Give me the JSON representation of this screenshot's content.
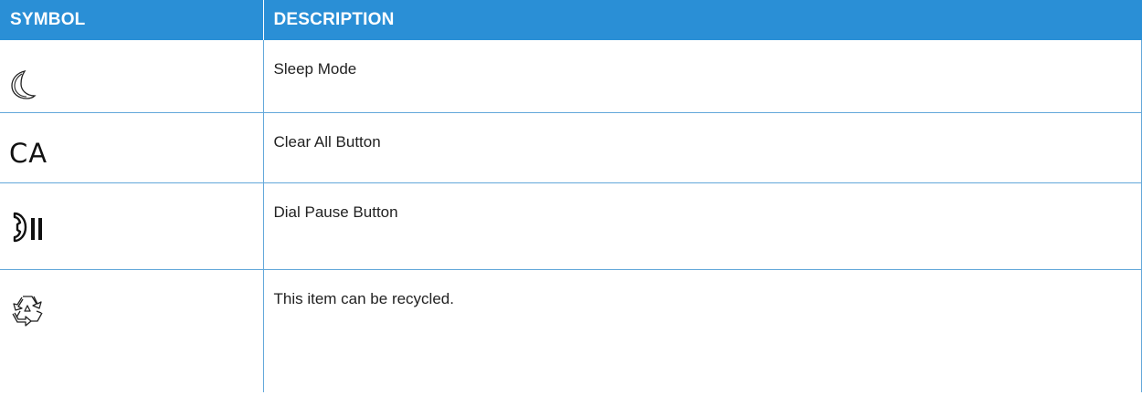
{
  "table": {
    "headers": {
      "symbol": "SYMBOL",
      "description": "DESCRIPTION"
    },
    "rows": [
      {
        "icon": "moon-icon",
        "description": "Sleep Mode"
      },
      {
        "icon": "ca-icon",
        "symbol_text": "CA",
        "description": "Clear All Button"
      },
      {
        "icon": "dial-pause-icon",
        "description": "Dial Pause Button"
      },
      {
        "icon": "recycle-icon",
        "description": "This item can be recycled."
      }
    ]
  },
  "colors": {
    "header_bg": "#2a8fd6",
    "header_text": "#ffffff",
    "rule": "#63a8da"
  }
}
